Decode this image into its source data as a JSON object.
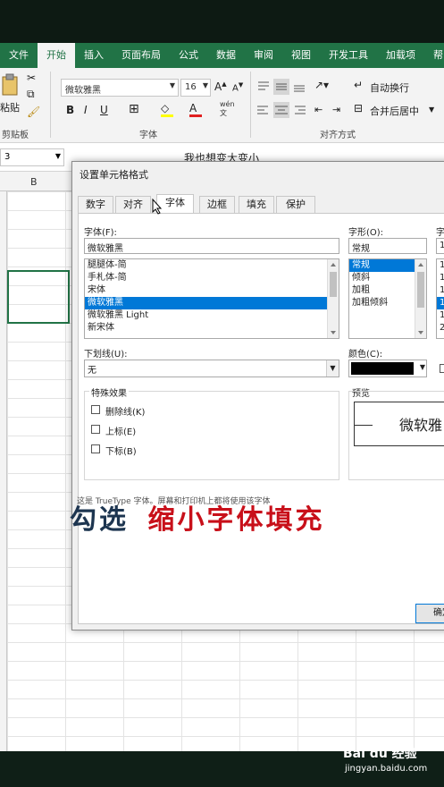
{
  "ribbon_tabs": [
    "文件",
    "开始",
    "插入",
    "页面布局",
    "公式",
    "数据",
    "审阅",
    "视图",
    "开发工具",
    "加载项",
    "帮"
  ],
  "active_tab_index": 1,
  "ribbon": {
    "paste_label": "粘贴",
    "clipboard_label": "剪贴板",
    "font_name": "微软雅黑",
    "font_size": "16",
    "font_group_label": "字体",
    "align_group_label": "对齐方式",
    "wrap_label": "自动换行",
    "merge_label": "合并后居中",
    "bold": "B",
    "italic": "I",
    "underline": "U",
    "font_color_letter": "A",
    "wen_label": "wén\n文"
  },
  "formula_bar": {
    "name_box": "3",
    "content": "我也想变大变小"
  },
  "sheet": {
    "col_b": "B"
  },
  "dialog": {
    "title": "设置单元格格式",
    "tabs": [
      "数字",
      "对齐",
      "字体",
      "边框",
      "填充",
      "保护"
    ],
    "active_tab_index": 2,
    "font_label": "字体(F):",
    "font_value": "微软雅黑",
    "font_list": [
      "腿腿体-简",
      "手札体-简",
      "宋体",
      "微软雅黑",
      "微软雅黑 Light",
      "新宋体"
    ],
    "font_selected_index": 3,
    "style_label": "字形(O):",
    "style_value": "常规",
    "style_list": [
      "常规",
      "倾斜",
      "加粗",
      "加粗倾斜"
    ],
    "style_selected_index": 0,
    "size_label": "字",
    "size_value": "1",
    "size_list": [
      "1",
      "1",
      "1",
      "1",
      "1",
      "2"
    ],
    "size_selected_index": 3,
    "underline_label": "下划线(U):",
    "underline_value": "无",
    "color_label": "颜色(C):",
    "color_value": "#000000",
    "effects_label": "特殊效果",
    "effects": [
      "删除线(K)",
      "上标(E)",
      "下标(B)"
    ],
    "preview_label": "预览",
    "preview_text": "微软雅",
    "note_text": "这是 TrueType 字体。屏幕和打印机上都将使用该字体",
    "ok_label": "确定"
  },
  "caption": {
    "part1": "勾选",
    "part2": "缩小字体填充"
  },
  "watermark": {
    "logo": "Bai du 经验",
    "url": "jingyan.baidu.com"
  },
  "colors": {
    "excel_green": "#217346",
    "caption_red": "#c8101a",
    "caption_blue": "#1d3550",
    "selection_blue": "#0078d7"
  }
}
